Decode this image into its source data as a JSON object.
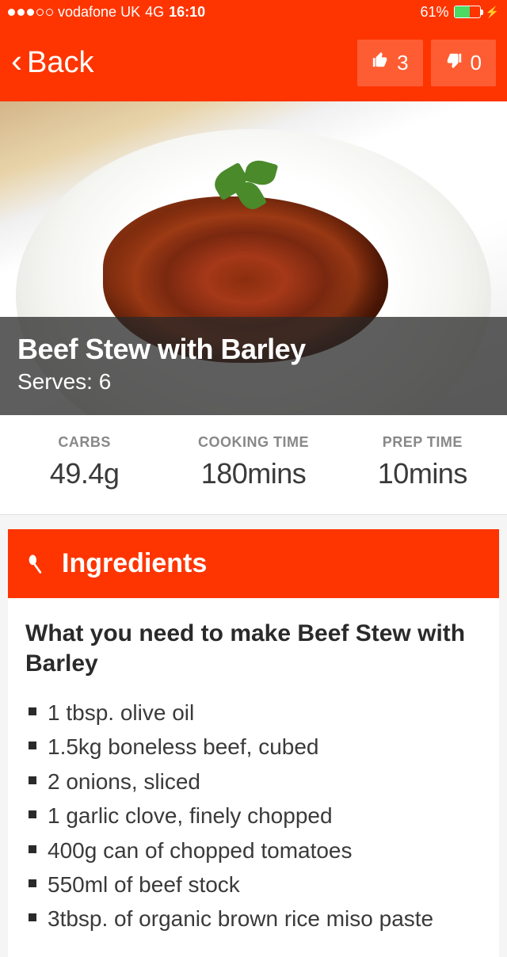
{
  "status": {
    "carrier": "vodafone UK",
    "network": "4G",
    "time": "16:10",
    "battery_pct": "61%"
  },
  "nav": {
    "back_label": "Back",
    "thumbs_up_count": "3",
    "thumbs_down_count": "0"
  },
  "hero": {
    "title": "Beef Stew with Barley",
    "serves": "Serves: 6"
  },
  "stats": {
    "carbs_label": "CARBS",
    "carbs_value": "49.4g",
    "cook_label": "COOKING TIME",
    "cook_value": "180mins",
    "prep_label": "PREP TIME",
    "prep_value": "10mins"
  },
  "ingredients": {
    "heading": "Ingredients",
    "subheading": "What you need to make Beef Stew with Barley",
    "items": [
      "1 tbsp. olive oil",
      "1.5kg boneless beef, cubed",
      "2 onions, sliced",
      "1 garlic clove, finely chopped",
      "400g can of chopped tomatoes",
      "550ml of beef stock",
      "3tbsp. of organic brown rice miso paste"
    ]
  }
}
